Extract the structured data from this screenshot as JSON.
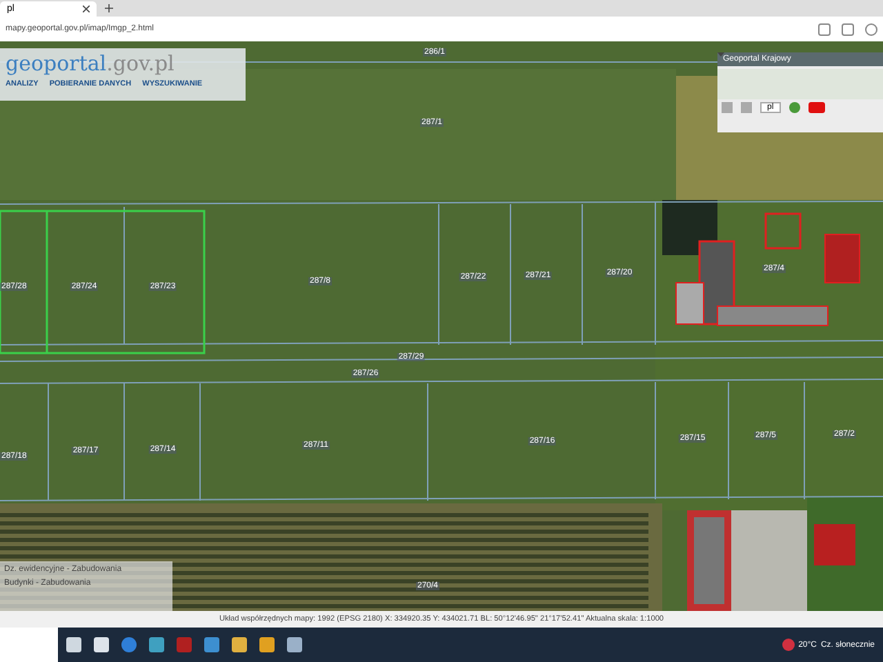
{
  "browser": {
    "tab_title": "pl",
    "address": "mapy.geoportal.gov.pl/imap/Imgp_2.html"
  },
  "logo": {
    "name": "geoportal",
    "domain": ".gov.pl"
  },
  "menu": [
    "ANALIZY",
    "POBIERANIE DANYCH",
    "WYSZUKIWANIE"
  ],
  "overview": {
    "title": "Geoportal Krajowy",
    "language": "pl"
  },
  "parcels": [
    "286/1",
    "287/1",
    "287/28",
    "287/24",
    "287/23",
    "287/8",
    "287/22",
    "287/21",
    "287/20",
    "287/4",
    "287/29",
    "287/26",
    "287/18",
    "287/17",
    "287/14",
    "287/11",
    "287/16",
    "287/15",
    "287/5",
    "287/2",
    "270/4"
  ],
  "legend": [
    "Dz. ewidencyjne - Zabudowania",
    "Budynki - Zabudowania"
  ],
  "status_bar": {
    "text": "Układ współrzędnych mapy: 1992 (EPSG 2180) X: 334920.35 Y: 434021.71  BL: 50°12'46.95\" 21°17'52.41\"  Aktualna skala: 1:1000"
  },
  "taskbar": {
    "weather": "20°C",
    "weather_text": "Cz. słonecznie"
  }
}
